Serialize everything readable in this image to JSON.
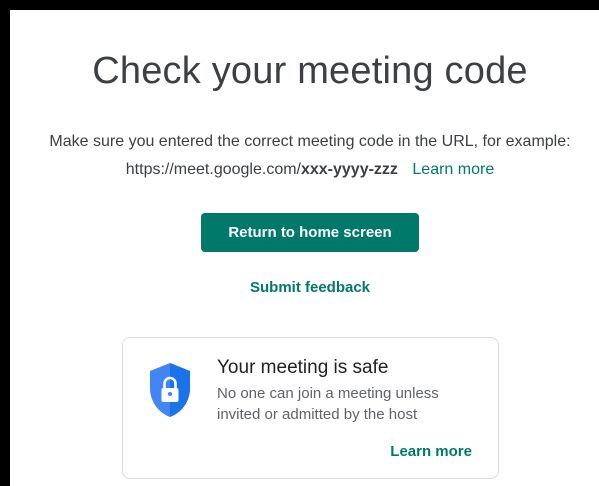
{
  "page": {
    "title": "Check your meeting code",
    "description_line1": "Make sure you entered the correct meeting code in the URL, for example:",
    "url_prefix": "https://meet.google.com/",
    "url_code": "xxx-yyyy-zzz",
    "learn_more_label": "Learn more",
    "return_button_label": "Return to home screen",
    "feedback_label": "Submit feedback"
  },
  "safety_card": {
    "title": "Your meeting is safe",
    "body": "No one can join a meeting unless invited or admitted by the host",
    "learn_more_label": "Learn more",
    "icon": "shield-lock-icon"
  },
  "colors": {
    "accent": "#00796b",
    "shield": "#4285f4",
    "text": "#3c4043"
  }
}
